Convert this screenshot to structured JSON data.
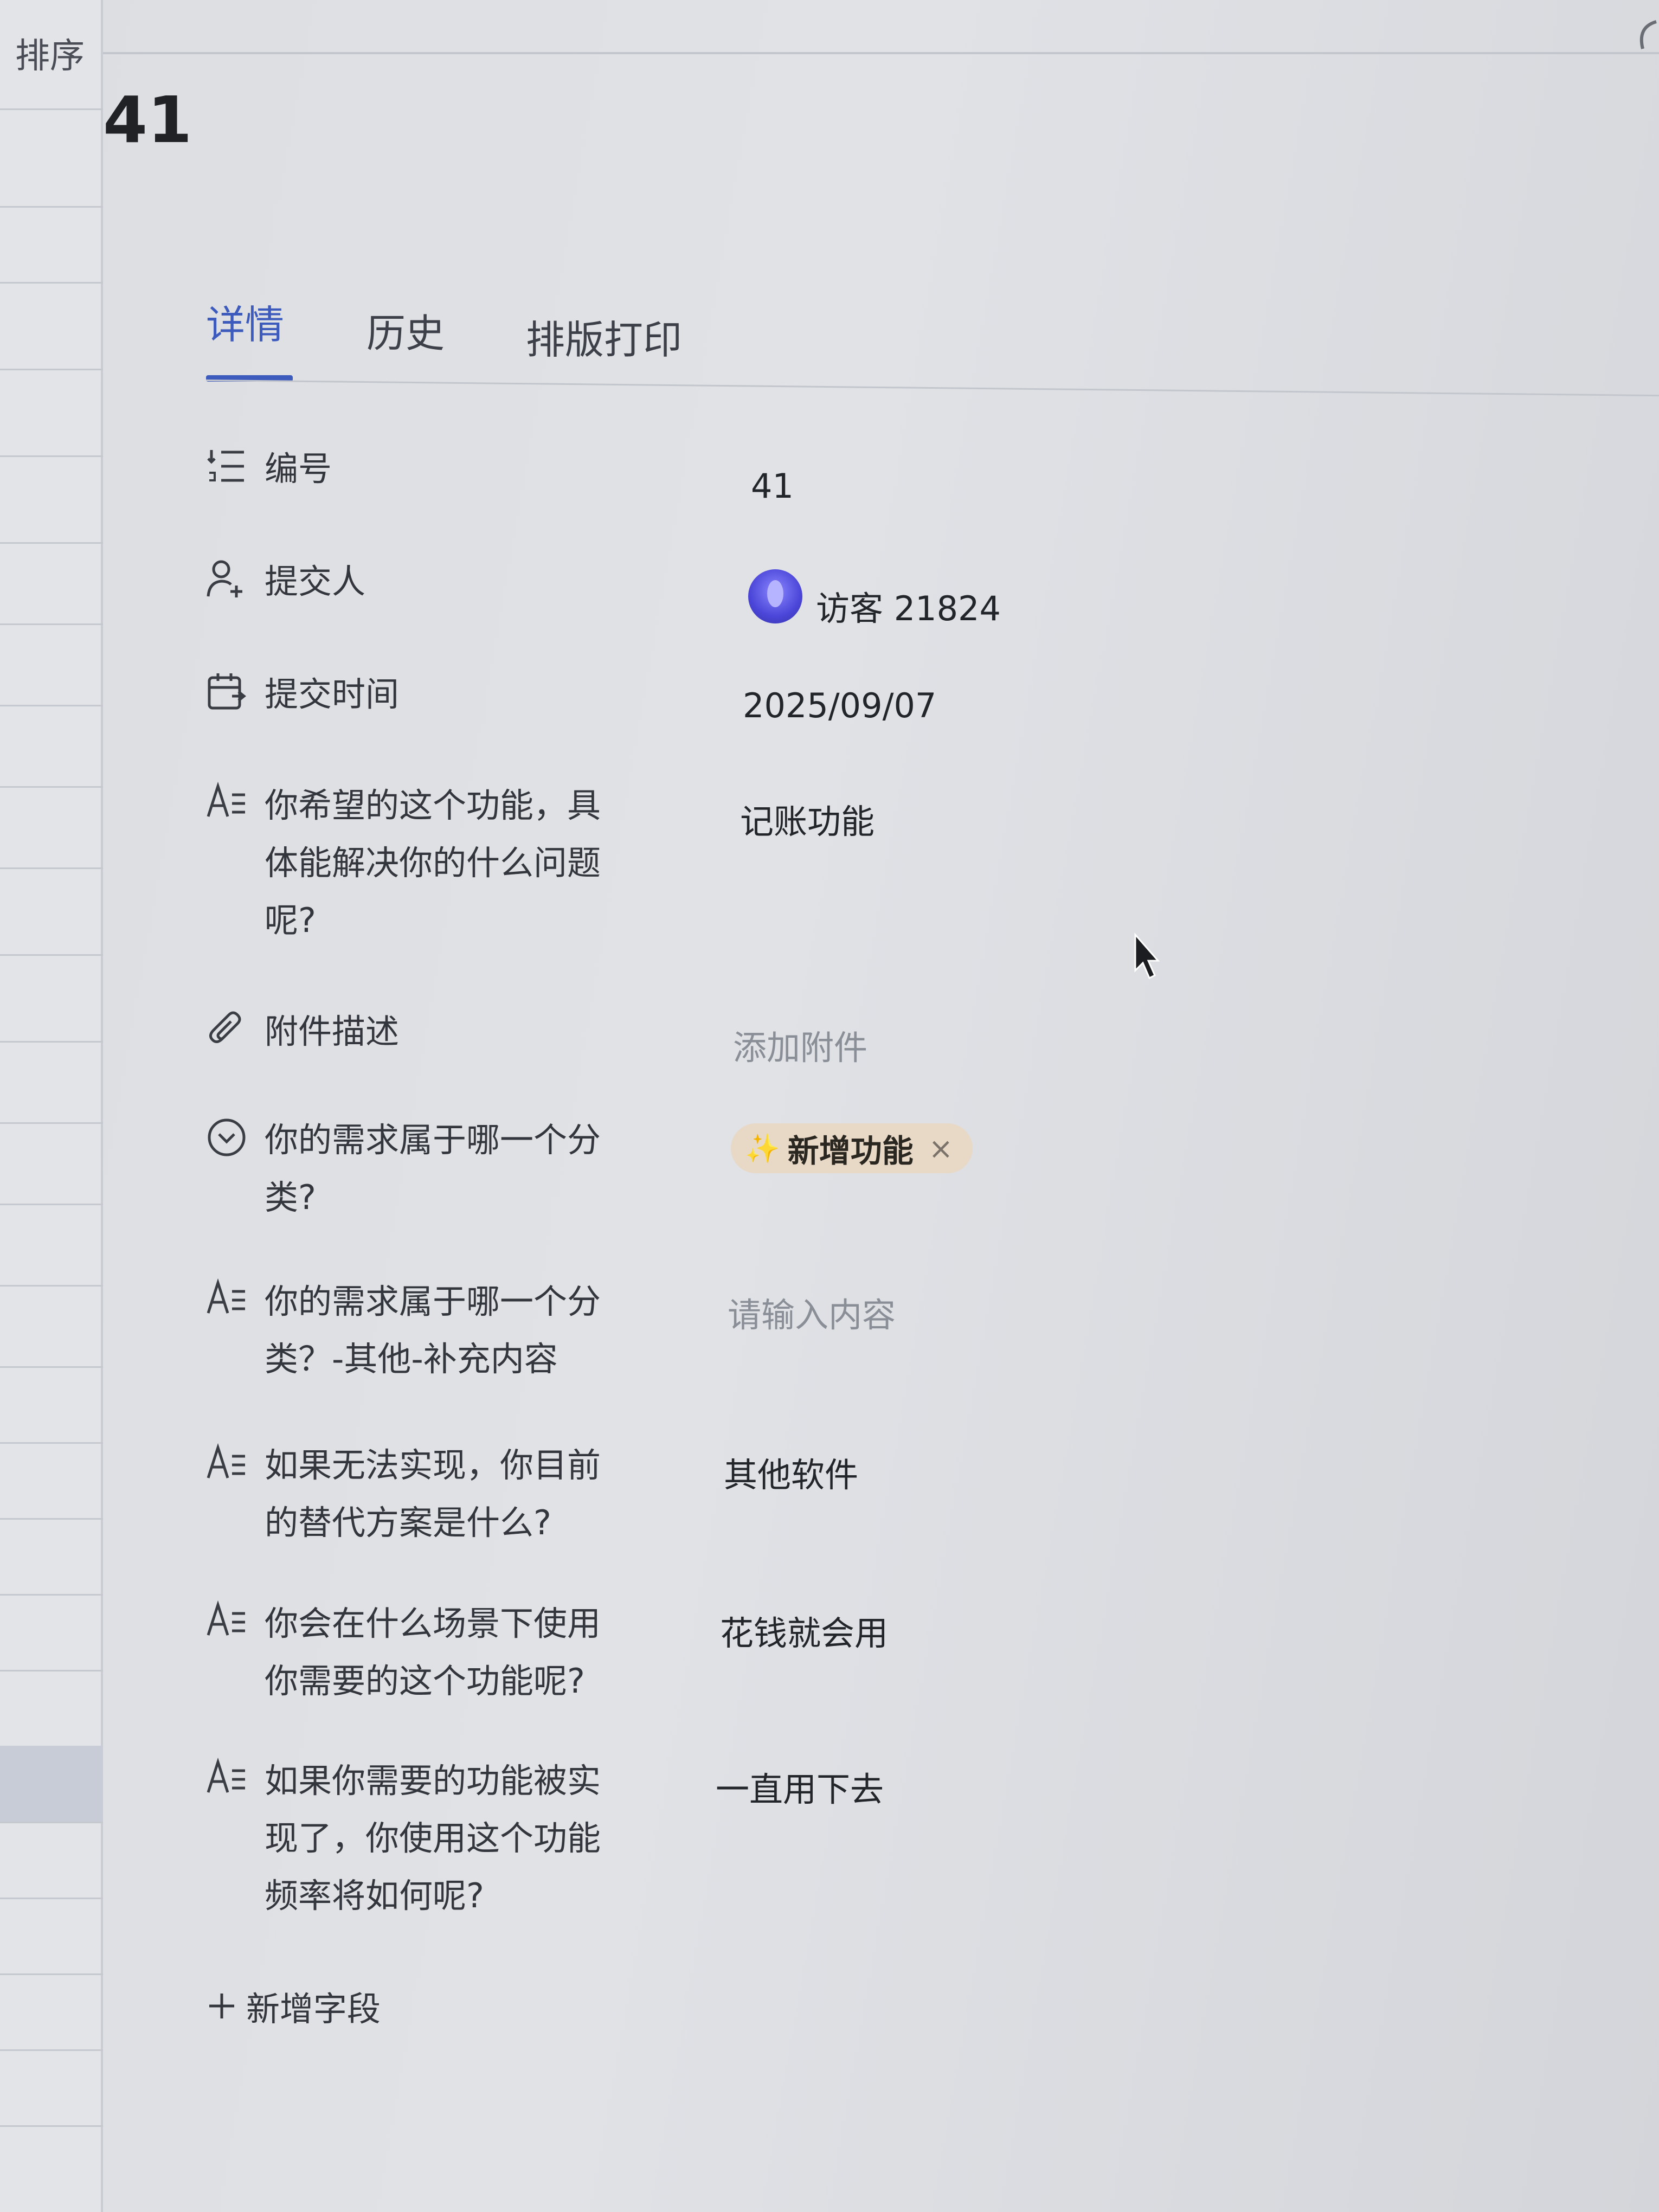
{
  "left_panel": {
    "sort_label": "排序"
  },
  "record": {
    "title": "41"
  },
  "tabs": [
    {
      "label": "详情",
      "active": true
    },
    {
      "label": "历史",
      "active": false
    },
    {
      "label": "排版打印",
      "active": false
    }
  ],
  "fields": [
    {
      "icon": "numbered-list-icon",
      "label": "编号",
      "value": "41"
    },
    {
      "icon": "add-user-icon",
      "label": "提交人",
      "value": "访客 21824"
    },
    {
      "icon": "calendar-edit-icon",
      "label": "提交时间",
      "value": "2025/09/07"
    },
    {
      "icon": "text-field-icon",
      "label_lines": [
        "你希望的这个功能，具",
        "体能解决你的什么问题",
        "呢?"
      ],
      "value": "记账功能"
    },
    {
      "icon": "paperclip-icon",
      "label": "附件描述",
      "placeholder": "添加附件"
    },
    {
      "icon": "single-select-icon",
      "label_lines": [
        "你的需求属于哪一个分",
        "类?"
      ],
      "tag": {
        "label": "新增功能",
        "remove": "×",
        "color": "#e8d8c6"
      }
    },
    {
      "icon": "text-field-icon",
      "label_lines": [
        "你的需求属于哪一个分",
        "类？-其他-补充内容"
      ],
      "placeholder": "请输入内容"
    },
    {
      "icon": "text-field-icon",
      "label_lines": [
        "如果无法实现，你目前",
        "的替代方案是什么?"
      ],
      "value": "其他软件"
    },
    {
      "icon": "text-field-icon",
      "label_lines": [
        "你会在什么场景下使用",
        "你需要的这个功能呢?"
      ],
      "value": "花钱就会用"
    },
    {
      "icon": "text-field-icon",
      "label_lines": [
        "如果你需要的功能被实",
        "现了，你使用这个功能",
        "频率将如何呢?"
      ],
      "value": "一直用下去"
    }
  ],
  "add_field": {
    "label": "新增字段"
  },
  "colors": {
    "accent": "#3d5bbd",
    "tag_bg": "#e8d8c6"
  }
}
